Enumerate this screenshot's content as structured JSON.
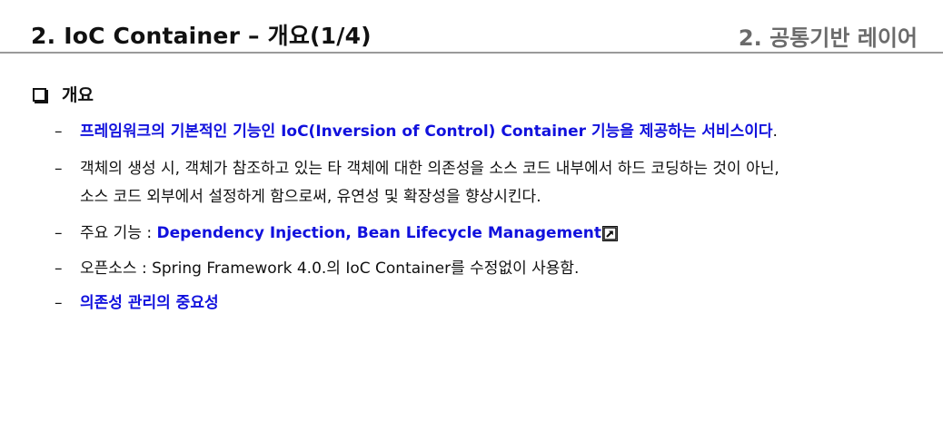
{
  "header": {
    "title": "2. IoC Container – 개요(1/4)",
    "section": "2. 공통기반 레이어"
  },
  "main": {
    "heading": "개요",
    "bullets": [
      {
        "dash": "–",
        "text": "프레임워크의 기본적인 기능인 IoC(Inversion of Control) Container 기능을 제공하는 서비스이다",
        "suffix": "."
      },
      {
        "dash": "–",
        "line1": "객체의 생성 시, 객체가 참조하고 있는 타 객체에 대한 의존성을 소스 코드 내부에서 하드 코딩하는 것이 아닌,",
        "line2": "소스 코드 외부에서 설정하게 함으로써, 유연성 및 확장성을 향상시킨다."
      },
      {
        "dash": "–",
        "prefix": "주요 기능 : ",
        "text": "Dependency Injection, Bean Lifecycle Management",
        "icon": "external-link-icon"
      },
      {
        "dash": "–",
        "text": "오픈소스 : Spring Framework 4.0.의 IoC Container를 수정없이 사용함."
      },
      {
        "dash": "–",
        "text": "의존성 관리의 중요성"
      }
    ]
  },
  "colors": {
    "accent_blue": "#1111dd",
    "rule_gray": "#9a9a9a",
    "section_gray": "#6b6b6b"
  }
}
